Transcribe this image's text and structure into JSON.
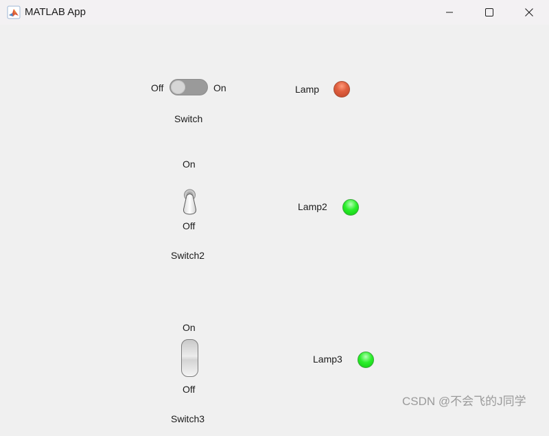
{
  "window": {
    "title": "MATLAB App",
    "app_icon": "matlab-logo-icon",
    "controls": [
      "minimize-icon",
      "maximize-icon",
      "close-icon"
    ]
  },
  "switch1": {
    "off_label": "Off",
    "on_label": "On",
    "label": "Switch",
    "value": "Off"
  },
  "lamp1": {
    "label": "Lamp",
    "color": "#d9593a"
  },
  "switch2": {
    "on_label": "On",
    "off_label": "Off",
    "label": "Switch2",
    "value": "Off"
  },
  "lamp2": {
    "label": "Lamp2",
    "color": "#22e622"
  },
  "switch3": {
    "on_label": "On",
    "off_label": "Off",
    "label": "Switch3",
    "value": "Off"
  },
  "lamp3": {
    "label": "Lamp3",
    "color": "#22e622"
  },
  "watermark": "CSDN @不会飞的J同学"
}
